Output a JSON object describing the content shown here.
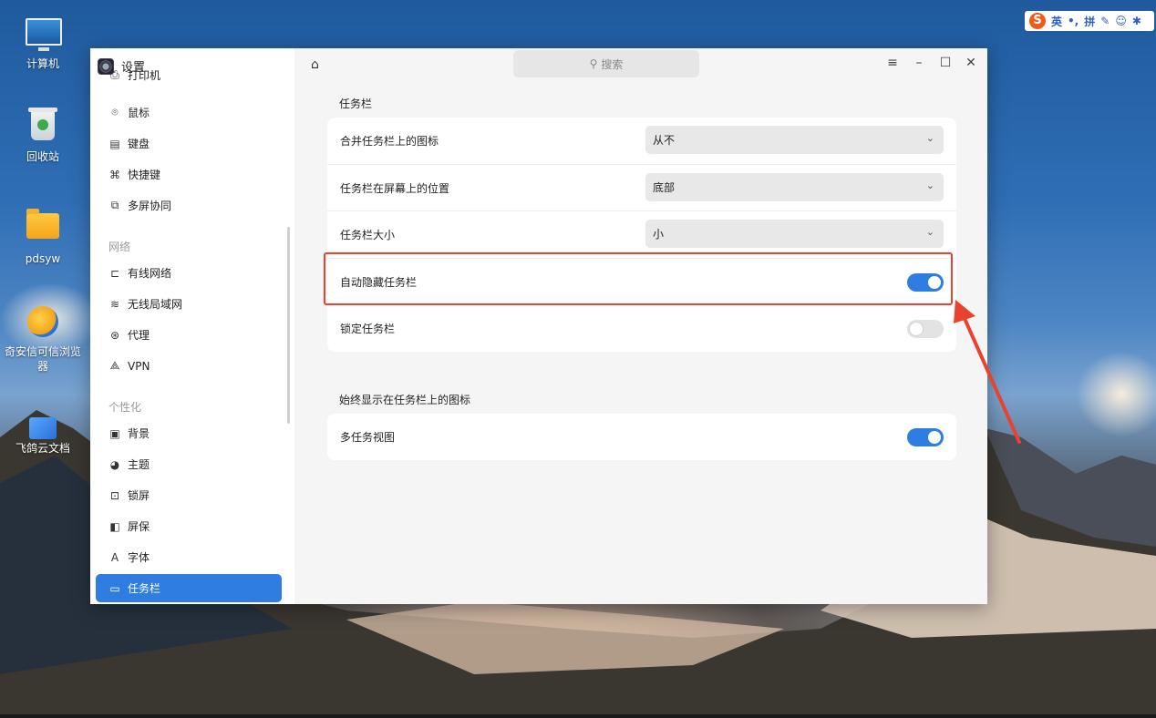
{
  "desktop": {
    "icons": [
      {
        "label": "计算机"
      },
      {
        "label": "回收站"
      },
      {
        "label": "pdsyw"
      },
      {
        "label": "奇安信可信浏览器"
      },
      {
        "label": "飞鸽云文档"
      }
    ]
  },
  "ime": {
    "logo": "S",
    "lang": "英",
    "punct": "•,",
    "mode": "拼"
  },
  "window": {
    "title": "设置",
    "search_placeholder": "搜索",
    "controls": {
      "menu": "≡",
      "minimize": "–",
      "maximize": "☐",
      "close": "✕"
    }
  },
  "sidebar": {
    "items_top": [
      {
        "label": "打印机",
        "icon": "printer-icon",
        "glyph": "⎙"
      },
      {
        "label": "鼠标",
        "icon": "mouse-icon",
        "glyph": "⌾"
      },
      {
        "label": "键盘",
        "icon": "keyboard-icon",
        "glyph": "▤"
      },
      {
        "label": "快捷键",
        "icon": "shortcut-icon",
        "glyph": "⌘"
      },
      {
        "label": "多屏协同",
        "icon": "multiscreen-icon",
        "glyph": "⧉"
      }
    ],
    "section_network": "网络",
    "items_network": [
      {
        "label": "有线网络",
        "icon": "wired-network-icon",
        "glyph": "⊏"
      },
      {
        "label": "无线局域网",
        "icon": "wifi-icon",
        "glyph": "≋"
      },
      {
        "label": "代理",
        "icon": "proxy-icon",
        "glyph": "⊛"
      },
      {
        "label": "VPN",
        "icon": "vpn-icon",
        "glyph": "⟁"
      }
    ],
    "section_personalize": "个性化",
    "items_personalize": [
      {
        "label": "背景",
        "icon": "background-icon",
        "glyph": "▣"
      },
      {
        "label": "主题",
        "icon": "theme-icon",
        "glyph": "◕"
      },
      {
        "label": "锁屏",
        "icon": "lockscreen-icon",
        "glyph": "⊡"
      },
      {
        "label": "屏保",
        "icon": "screensaver-icon",
        "glyph": "◧"
      },
      {
        "label": "字体",
        "icon": "font-icon",
        "glyph": "A"
      },
      {
        "label": "任务栏",
        "icon": "taskbar-icon",
        "glyph": "▭"
      }
    ]
  },
  "main": {
    "section1_title": "任务栏",
    "rows": {
      "merge_icons": {
        "label": "合并任务栏上的图标",
        "value": "从不"
      },
      "position": {
        "label": "任务栏在屏幕上的位置",
        "value": "底部"
      },
      "size": {
        "label": "任务栏大小",
        "value": "小"
      },
      "autohide": {
        "label": "自动隐藏任务栏",
        "on": true
      },
      "lock": {
        "label": "锁定任务栏",
        "on": false
      }
    },
    "section2_title": "始终显示在任务栏上的图标",
    "multitask": {
      "label": "多任务视图",
      "on": true
    }
  },
  "annotation": {
    "highlight_color": "#e8432e",
    "accent": "#2f7de1"
  }
}
